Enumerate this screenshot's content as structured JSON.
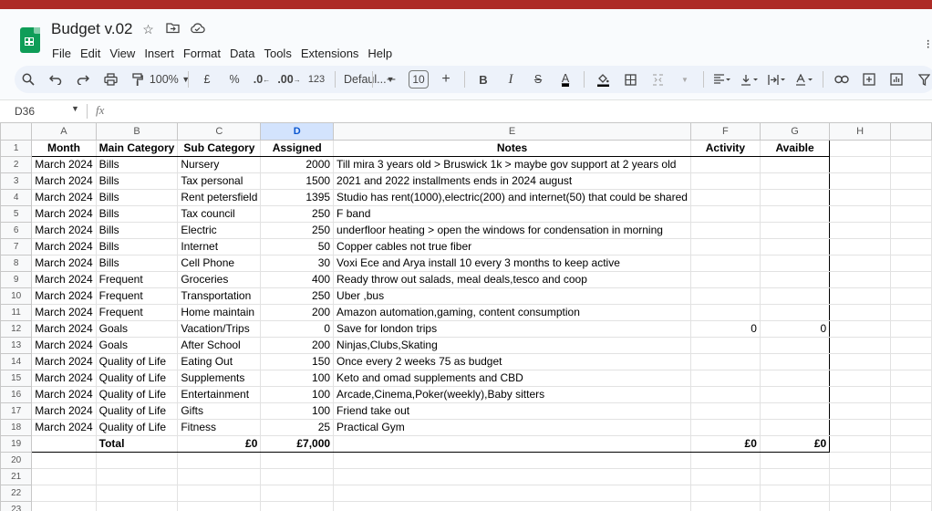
{
  "app": {
    "doc_title": "Budget v.02",
    "menus": [
      "File",
      "Edit",
      "View",
      "Insert",
      "Format",
      "Data",
      "Tools",
      "Extensions",
      "Help"
    ]
  },
  "toolbar": {
    "zoom": "100%",
    "currency": "£",
    "percent": "%",
    "dec_less": ".0",
    "dec_more": ".00",
    "num_format": "123",
    "font": "Defaul...",
    "font_size": "10",
    "bold": "B",
    "italic": "I",
    "strike": "S",
    "text_color": "A"
  },
  "formula_bar": {
    "cell_ref": "D36",
    "fx": "fx",
    "value": ""
  },
  "columns": [
    "A",
    "B",
    "C",
    "D",
    "E",
    "F",
    "G",
    "H"
  ],
  "selected_column": "D",
  "header_row": {
    "row_num": "1",
    "cells": [
      "Month",
      "Main Category",
      "Sub Category",
      "Assigned",
      "Notes",
      "Activity",
      "Avaible",
      ""
    ]
  },
  "rows": [
    {
      "n": "2",
      "month": "March 2024",
      "main": "Bills",
      "sub": "Nursery",
      "assigned": "2000",
      "notes": "Till mira 3 years old > Bruswick 1k > maybe gov support at 2 years old",
      "activity": "",
      "avail": ""
    },
    {
      "n": "3",
      "month": "March 2024",
      "main": "Bills",
      "sub": "Tax personal",
      "assigned": "1500",
      "notes": "2021 and 2022 installments ends in 2024 august",
      "activity": "",
      "avail": ""
    },
    {
      "n": "4",
      "month": "March 2024",
      "main": "Bills",
      "sub": "Rent petersfield",
      "assigned": "1395",
      "notes": "Studio has rent(1000),electric(200) and internet(50) that could be shared",
      "activity": "",
      "avail": ""
    },
    {
      "n": "5",
      "month": "March 2024",
      "main": "Bills",
      "sub": "Tax council",
      "assigned": "250",
      "notes": "F band",
      "activity": "",
      "avail": ""
    },
    {
      "n": "6",
      "month": "March 2024",
      "main": "Bills",
      "sub": "Electric",
      "assigned": "250",
      "notes": "underfloor heating > open the windows for condensation in morning",
      "activity": "",
      "avail": ""
    },
    {
      "n": "7",
      "month": "March 2024",
      "main": "Bills",
      "sub": "Internet",
      "assigned": "50",
      "notes": "Copper cables not true fiber",
      "activity": "",
      "avail": ""
    },
    {
      "n": "8",
      "month": "March 2024",
      "main": "Bills",
      "sub": "Cell Phone",
      "assigned": "30",
      "notes": "Voxi Ece and Arya install 10 every 3 months to keep active",
      "activity": "",
      "avail": ""
    },
    {
      "n": "9",
      "month": "March 2024",
      "main": "Frequent",
      "sub": "Groceries",
      "assigned": "400",
      "notes": "Ready throw out salads, meal deals,tesco and coop",
      "activity": "",
      "avail": ""
    },
    {
      "n": "10",
      "month": "March 2024",
      "main": "Frequent",
      "sub": "Transportation",
      "assigned": "250",
      "notes": "Uber ,bus",
      "activity": "",
      "avail": ""
    },
    {
      "n": "11",
      "month": "March 2024",
      "main": "Frequent",
      "sub": "Home maintain",
      "assigned": "200",
      "notes": "Amazon automation,gaming, content consumption",
      "activity": "",
      "avail": ""
    },
    {
      "n": "12",
      "month": "March 2024",
      "main": "Goals",
      "sub": "Vacation/Trips",
      "assigned": "0",
      "notes": "Save for london trips",
      "activity": "0",
      "avail": "0"
    },
    {
      "n": "13",
      "month": "March 2024",
      "main": "Goals",
      "sub": "After School",
      "assigned": "200",
      "notes": "Ninjas,Clubs,Skating",
      "activity": "",
      "avail": ""
    },
    {
      "n": "14",
      "month": "March 2024",
      "main": "Quality of Life",
      "sub": "Eating Out",
      "assigned": "150",
      "notes": "Once every 2 weeks 75 as budget",
      "activity": "",
      "avail": ""
    },
    {
      "n": "15",
      "month": "March 2024",
      "main": "Quality of Life",
      "sub": "Supplements",
      "assigned": "100",
      "notes": "Keto and omad supplements and CBD",
      "activity": "",
      "avail": ""
    },
    {
      "n": "16",
      "month": "March 2024",
      "main": "Quality of Life",
      "sub": "Entertainment",
      "assigned": "100",
      "notes": "Arcade,Cinema,Poker(weekly),Baby sitters",
      "activity": "",
      "avail": ""
    },
    {
      "n": "17",
      "month": "March 2024",
      "main": "Quality of Life",
      "sub": "Gifts",
      "assigned": "100",
      "notes": "Friend take out",
      "activity": "",
      "avail": ""
    },
    {
      "n": "18",
      "month": "March 2024",
      "main": "Quality of Life",
      "sub": "Fitness",
      "assigned": "25",
      "notes": "Practical Gym",
      "activity": "",
      "avail": ""
    }
  ],
  "total_row": {
    "n": "19",
    "label": "Total",
    "c": "£0",
    "d": "£7,000",
    "f": "£0",
    "g": "£0"
  },
  "empty_rows": [
    "20",
    "21",
    "22",
    "23"
  ],
  "colors": {
    "sheets_green": "#0f9d58",
    "top_bar": "#ad2b26",
    "selected_col": "#d3e3fd"
  }
}
